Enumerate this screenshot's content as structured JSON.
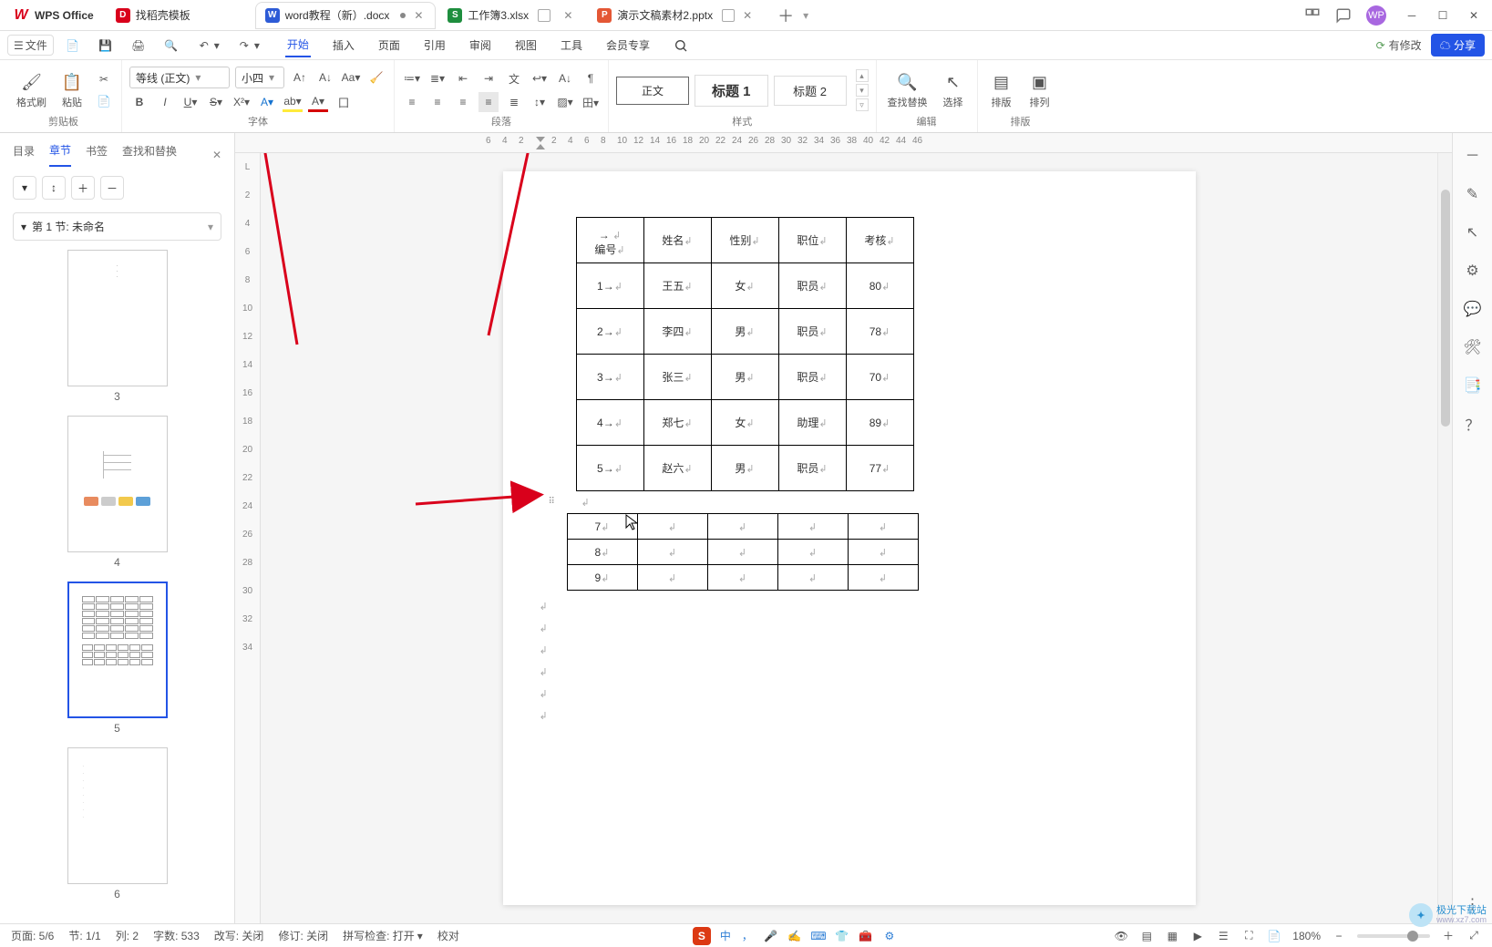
{
  "title_bar": {
    "logo_text": "WPS Office",
    "tabs": [
      {
        "icon": "wdoc",
        "icon_letter": "D",
        "label": "找稻壳模板"
      },
      {
        "icon": "wword",
        "icon_letter": "W",
        "label": "word教程（新）.docx",
        "modified": true
      },
      {
        "icon": "wxls",
        "icon_letter": "S",
        "label": "工作簿3.xlsx",
        "window_indicator": true
      },
      {
        "icon": "wppt",
        "icon_letter": "P",
        "label": "演示文稿素材2.pptx",
        "window_indicator": true
      }
    ],
    "avatar_text": "WP"
  },
  "menubar": {
    "file_label": "文件",
    "ribbon_tabs": [
      "开始",
      "插入",
      "页面",
      "引用",
      "审阅",
      "视图",
      "工具",
      "会员专享"
    ],
    "active_ribbon": "开始",
    "modified_text": "有修改",
    "share_text": "分享"
  },
  "ribbon": {
    "clipboard": {
      "format_painter": "格式刷",
      "paste": "粘贴",
      "group_label": "剪贴板"
    },
    "font": {
      "font_family": "等线 (正文)",
      "font_size": "小四",
      "group_label": "字体"
    },
    "paragraph": {
      "group_label": "段落"
    },
    "styles": {
      "items": [
        "正文",
        "标题 1",
        "标题 2"
      ],
      "group_label": "样式"
    },
    "editing": {
      "find_replace": "查找替换",
      "select": "选择",
      "group_label": "编辑"
    },
    "arrange": {
      "sort": "排版",
      "align": "排列",
      "group_label": "排版"
    }
  },
  "sidepanel": {
    "tabs": [
      "目录",
      "章节",
      "书签",
      "查找和替换"
    ],
    "active_tab": "章节",
    "section_title": "第 1 节: 未命名",
    "page_numbers": [
      "3",
      "4",
      "5",
      "6"
    ]
  },
  "ruler_h_ticks": [
    "6",
    "4",
    "2",
    "",
    "2",
    "4",
    "6",
    "8",
    "10",
    "12",
    "14",
    "16",
    "18",
    "20",
    "22",
    "24",
    "26",
    "28",
    "30",
    "32",
    "34",
    "36",
    "38",
    "40",
    "42",
    "44",
    "46"
  ],
  "ruler_v_ticks": [
    "L",
    "",
    "2",
    "4",
    "6",
    "8",
    "10",
    "12",
    "14",
    "16",
    "18",
    "20",
    "22",
    "24",
    "26",
    "28",
    "30",
    "32",
    "34"
  ],
  "document": {
    "table1": {
      "headers": [
        "编号",
        "姓名",
        "性别",
        "职位",
        "考核"
      ],
      "rows": [
        [
          "1",
          "王五",
          "女",
          "职员",
          "80"
        ],
        [
          "2",
          "李四",
          "男",
          "职员",
          "78"
        ],
        [
          "3",
          "张三",
          "男",
          "职员",
          "70"
        ],
        [
          "4",
          "郑七",
          "女",
          "助理",
          "89"
        ],
        [
          "5",
          "赵六",
          "男",
          "职员",
          "77"
        ]
      ]
    },
    "table2": {
      "rows": [
        [
          "7",
          "",
          "",
          "",
          "",
          ""
        ],
        [
          "8",
          "",
          "",
          "",
          "",
          ""
        ],
        [
          "9",
          "",
          "",
          "",
          "",
          ""
        ]
      ]
    }
  },
  "statusbar": {
    "page": "页面: 5/6",
    "section": "节: 1/1",
    "column": "列: 2",
    "word_count": "字数: 533",
    "track_changes": "改写: 关闭",
    "revision": "修订: 关闭",
    "spellcheck": "拼写检查: 打开",
    "proofread": "校对",
    "ime_mode": "中",
    "zoom": "180%"
  },
  "watermark": {
    "title": "极光下载站",
    "url": "www.xz7.com"
  }
}
